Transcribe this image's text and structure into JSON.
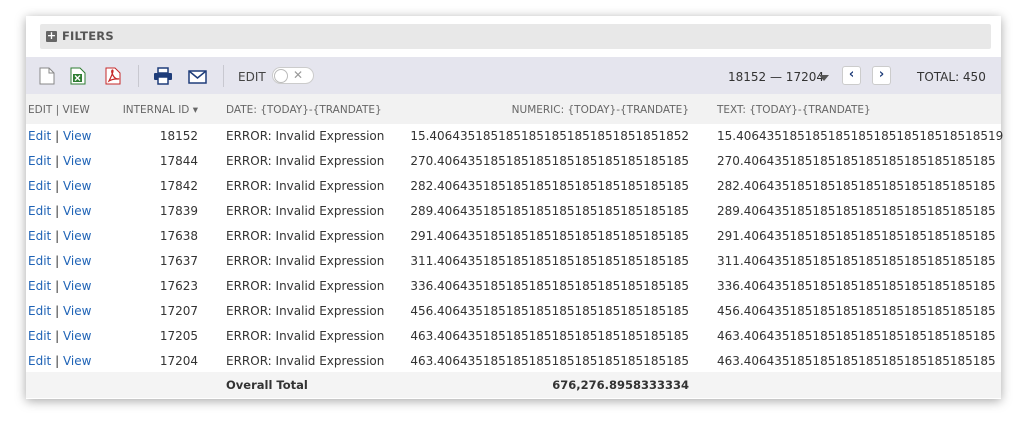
{
  "filters": {
    "label": "FILTERS"
  },
  "toolbar": {
    "icons": [
      "new-document-icon",
      "export-excel-icon",
      "export-pdf-icon",
      "print-icon",
      "email-icon"
    ],
    "edit_label": "EDIT",
    "edit_toggle_on": false,
    "range_label": "18152 — 17204",
    "total_label": "TOTAL: 450"
  },
  "columns": {
    "edit_view": "EDIT | VIEW",
    "internal_id": "INTERNAL ID ▾",
    "date": "DATE: {TODAY}-{TRANDATE}",
    "numeric": "NUMERIC: {TODAY}-{TRANDATE}",
    "text": "TEXT: {TODAY}-{TRANDATE}"
  },
  "rows": [
    {
      "edit": "Edit",
      "sep": "|",
      "view": "View",
      "id": "18152",
      "date": "ERROR: Invalid Expression",
      "numeric": "15.4064351851851851851851851851851852",
      "text": "15.40643518518518518518518518518518519"
    },
    {
      "edit": "Edit",
      "sep": "|",
      "view": "View",
      "id": "17844",
      "date": "ERROR: Invalid Expression",
      "numeric": "270.406435185185185185185185185185185",
      "text": "270.406435185185185185185185185185185"
    },
    {
      "edit": "Edit",
      "sep": "|",
      "view": "View",
      "id": "17842",
      "date": "ERROR: Invalid Expression",
      "numeric": "282.406435185185185185185185185185185",
      "text": "282.406435185185185185185185185185185"
    },
    {
      "edit": "Edit",
      "sep": "|",
      "view": "View",
      "id": "17839",
      "date": "ERROR: Invalid Expression",
      "numeric": "289.406435185185185185185185185185185",
      "text": "289.406435185185185185185185185185185"
    },
    {
      "edit": "Edit",
      "sep": "|",
      "view": "View",
      "id": "17638",
      "date": "ERROR: Invalid Expression",
      "numeric": "291.406435185185185185185185185185185",
      "text": "291.406435185185185185185185185185185"
    },
    {
      "edit": "Edit",
      "sep": "|",
      "view": "View",
      "id": "17637",
      "date": "ERROR: Invalid Expression",
      "numeric": "311.406435185185185185185185185185185",
      "text": "311.406435185185185185185185185185185"
    },
    {
      "edit": "Edit",
      "sep": "|",
      "view": "View",
      "id": "17623",
      "date": "ERROR: Invalid Expression",
      "numeric": "336.406435185185185185185185185185185",
      "text": "336.406435185185185185185185185185185"
    },
    {
      "edit": "Edit",
      "sep": "|",
      "view": "View",
      "id": "17207",
      "date": "ERROR: Invalid Expression",
      "numeric": "456.406435185185185185185185185185185",
      "text": "456.406435185185185185185185185185185"
    },
    {
      "edit": "Edit",
      "sep": "|",
      "view": "View",
      "id": "17205",
      "date": "ERROR: Invalid Expression",
      "numeric": "463.406435185185185185185185185185185",
      "text": "463.406435185185185185185185185185185"
    },
    {
      "edit": "Edit",
      "sep": "|",
      "view": "View",
      "id": "17204",
      "date": "ERROR: Invalid Expression",
      "numeric": "463.406435185185185185185185185185185",
      "text": "463.406435185185185185185185185185185"
    }
  ],
  "totals": {
    "label": "Overall Total",
    "numeric": "676,276.8958333334"
  },
  "colors": {
    "link": "#1f63b6",
    "toolbar_bg": "#e5e5ee",
    "icon_blue": "#1f3d7a",
    "excel_green": "#2e7d32",
    "pdf_red": "#c62828"
  }
}
